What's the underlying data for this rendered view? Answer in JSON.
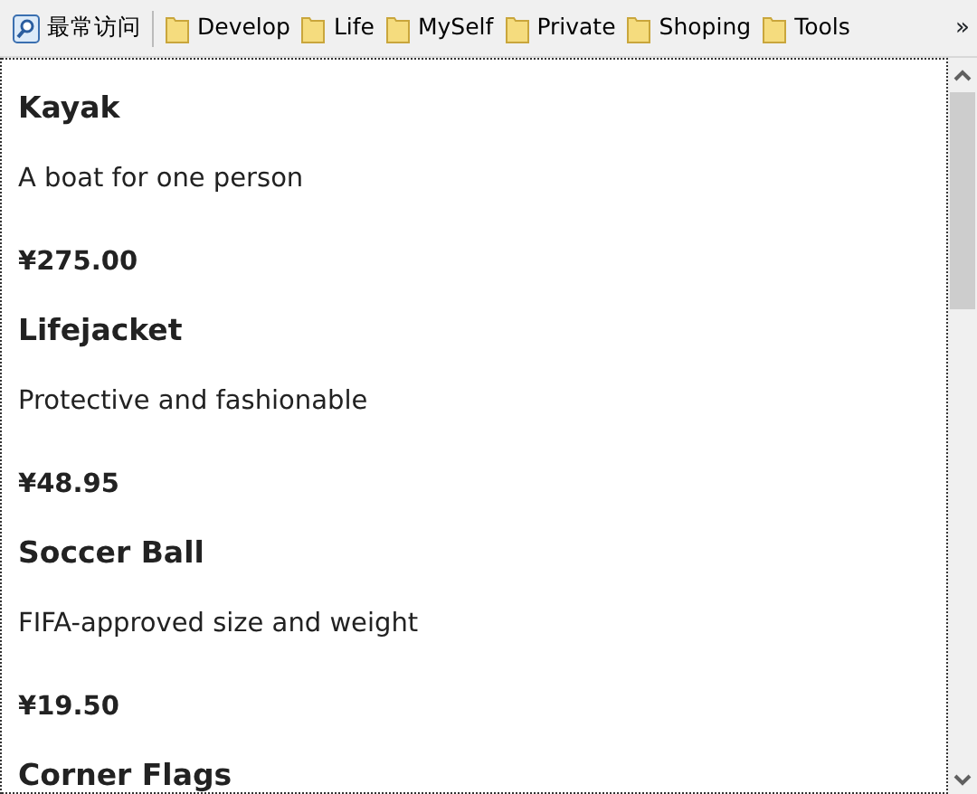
{
  "bookmarks_bar": {
    "items": [
      {
        "label": "最常访问",
        "kind": "special"
      },
      {
        "label": "Develop",
        "kind": "folder"
      },
      {
        "label": "Life",
        "kind": "folder"
      },
      {
        "label": "MySelf",
        "kind": "folder"
      },
      {
        "label": "Private",
        "kind": "folder"
      },
      {
        "label": "Shoping",
        "kind": "folder"
      },
      {
        "label": "Tools",
        "kind": "folder"
      }
    ],
    "overflow": "»"
  },
  "products": [
    {
      "name": "Kayak",
      "description": "A boat for one person",
      "price": "¥275.00"
    },
    {
      "name": "Lifejacket",
      "description": "Protective and fashionable",
      "price": "¥48.95"
    },
    {
      "name": "Soccer Ball",
      "description": "FIFA-approved size and weight",
      "price": "¥19.50"
    },
    {
      "name": "Corner Flags"
    }
  ]
}
